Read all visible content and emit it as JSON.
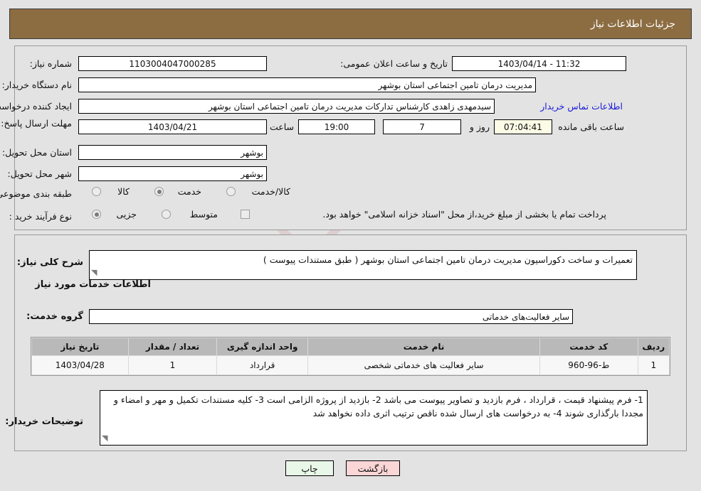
{
  "header": {
    "title": "جزئیات اطلاعات نیاز"
  },
  "watermark": {
    "text": "AriaTender.net"
  },
  "form": {
    "need_number_label": "شماره نیاز:",
    "need_number_value": "1103004047000285",
    "public_announce_label": "تاریخ و ساعت اعلان عمومی:",
    "public_announce_value": "11:32 - 1403/04/14",
    "buyer_org_label": "نام دستگاه خریدار:",
    "buyer_org_value": "مدیریت درمان تامین اجتماعی استان بوشهر",
    "requester_label": "ایجاد کننده درخواست:",
    "requester_value": "سیدمهدی زاهدی کارشناس تدارکات مدیریت درمان تامین اجتماعی استان بوشهر",
    "contact_link": "اطلاعات تماس خریدار",
    "deadline_label": "مهلت ارسال پاسخ: تا تاریخ:",
    "deadline_date": "1403/04/21",
    "hour_label": "ساعت",
    "deadline_time": "19:00",
    "days_value": "7",
    "days_label": "روز و",
    "countdown_value": "07:04:41",
    "countdown_label": "ساعت باقی مانده",
    "province_label": "استان محل تحویل:",
    "province_value": "بوشهر",
    "city_label": "شهر محل تحویل:",
    "city_value": "بوشهر",
    "category_label": "طبقه بندی موضوعی:",
    "category_options": [
      "کالا",
      "خدمت",
      "کالا/خدمت"
    ],
    "category_selected": "خدمت",
    "process_label": "نوع فرآیند خرید :",
    "process_options": [
      "جزیی",
      "متوسط"
    ],
    "process_selected": "جزیی",
    "treasury_checkbox_label": "پرداخت تمام یا بخشی از مبلغ خرید،از محل \"اسناد خزانه اسلامی\" خواهد بود.",
    "treasury_checked": false
  },
  "description": {
    "general_label": "شرح کلی نیاز:",
    "general_value": "تعمیرات و ساخت دکوراسیون مدیریت درمان تامین اجتماعی استان بوشهر ( طبق مستندات پیوست )",
    "services_heading": "اطلاعات خدمات مورد نیاز",
    "service_group_label": "گروه خدمت:",
    "service_group_value": "سایر فعالیت‌های خدماتی"
  },
  "table": {
    "columns": [
      "ردیف",
      "کد خدمت",
      "نام خدمت",
      "واحد اندازه گیری",
      "تعداد / مقدار",
      "تاریخ نیاز"
    ],
    "rows": [
      {
        "row_no": "1",
        "service_code": "ط-96-960",
        "service_name": "سایر فعالیت های خدماتی شخصی",
        "unit": "قرارداد",
        "quantity": "1",
        "need_date": "1403/04/28"
      }
    ]
  },
  "buyer_notes": {
    "label": "توضیحات خریدار:",
    "value": "1- فرم پیشنهاد قیمت ، قرارداد ، فرم بازدید و تصاویر پیوست می باشد 2- بازدید از پروژه الزامی است 3- کلیه مستندات تکمیل و مهر و امضاء و مجددا بارگذاری شوند 4- به درخواست های ارسال شده ناقص ترتیب اثری داده نخواهد شد"
  },
  "buttons": {
    "print": "چاپ",
    "back": "بازگشت"
  },
  "colors": {
    "header_bg": "#8c6d42",
    "page_bg": "#e3e3e3",
    "link": "#1a1ad6",
    "print_btn": "#e9f7e9",
    "back_btn": "#fbd6d6",
    "countdown_bg": "#fbfbe6",
    "table_header_bg": "#b9b9b9"
  }
}
